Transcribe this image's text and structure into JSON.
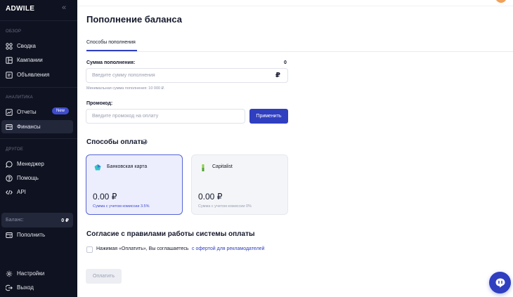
{
  "brand": {
    "logo": "ADWILE",
    "accent": "#2f3fc0",
    "sidebar_bg": "#0f1220"
  },
  "sidebar": {
    "collapse_icon": "chevron-double-left-icon",
    "sections": {
      "overview": "ОБЗОР",
      "analytics": "АНАЛИТИКА",
      "other": "ДРУГОЕ"
    },
    "items": {
      "summary": {
        "label": "Сводка",
        "icon": "grid-icon"
      },
      "campaigns": {
        "label": "Кампании",
        "icon": "columns-icon"
      },
      "ads": {
        "label": "Объявления",
        "icon": "document-icon"
      },
      "reports": {
        "label": "Отчеты",
        "icon": "chart-icon",
        "badge": "New"
      },
      "finance": {
        "label": "Финансы",
        "icon": "wallet-icon"
      },
      "manager": {
        "label": "Менеджер",
        "icon": "chat-icon"
      },
      "help": {
        "label": "Помощь",
        "icon": "question-icon"
      },
      "api": {
        "label": "API",
        "icon": "code-icon"
      },
      "topup": {
        "label": "Пополнить",
        "icon": "wallet-icon"
      },
      "settings": {
        "label": "Настройки",
        "icon": "gear-icon"
      },
      "logout": {
        "label": "Выход",
        "icon": "logout-icon"
      }
    },
    "balance": {
      "label": "Баланс:",
      "value": "0 ₽"
    }
  },
  "main": {
    "title": "Пополнение баланса",
    "tab": "Способы пополнения",
    "amount": {
      "label": "Сумма пополнения:",
      "count": "0",
      "placeholder": "Введите сумму пополнения",
      "currency": "₽",
      "hint": "Минимальная сумма пополнения: 10 000 ₽."
    },
    "promo": {
      "label": "Промокод:",
      "placeholder": "Введите промокод на оплату",
      "apply": "Применить"
    },
    "methods": {
      "title": "Способы оплаты",
      "cards": [
        {
          "name": "Банковская карта",
          "amount": "0.00 ₽",
          "fee": "Сумма с учетом комиссии 3.5%"
        },
        {
          "name": "Capitalist",
          "amount": "0.00 ₽",
          "fee": "Сумма с учетом комиссии 0%"
        }
      ]
    },
    "agreement": {
      "title": "Согласие с правилами работы системы оплаты",
      "text": "Нажимая «Оплатить», Вы соглашаетесь",
      "link": "с офертой для рекламодателей"
    },
    "pay": "Оплатить"
  }
}
